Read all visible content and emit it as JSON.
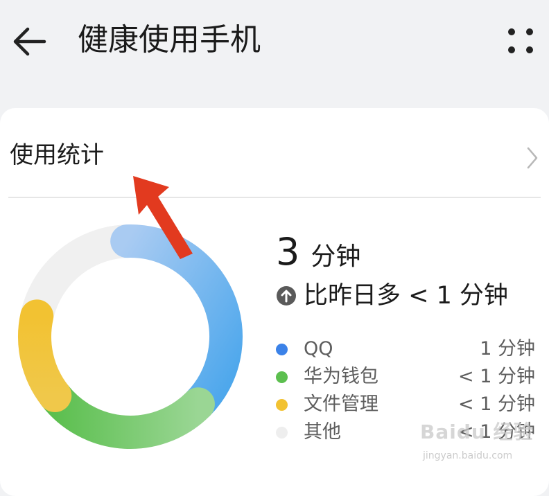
{
  "header": {
    "title": "健康使用手机",
    "back_icon": "arrow-left-icon",
    "more_icon": "more-dots-icon"
  },
  "stats": {
    "title": "使用统计",
    "chevron_icon": "chevron-right-icon"
  },
  "summary": {
    "total_value": "3",
    "total_unit": "分钟",
    "compare_icon": "arrow-up-circle-icon",
    "compare_text": "比昨日多 < 1 分钟"
  },
  "legend": [
    {
      "name": "QQ",
      "value": "1 分钟",
      "color": "#3b82e8"
    },
    {
      "name": "华为钱包",
      "value": "< 1 分钟",
      "color": "#5cbf4f"
    },
    {
      "name": "文件管理",
      "value": "< 1 分钟",
      "color": "#f2c232"
    },
    {
      "name": "其他",
      "value": "< 1 分钟",
      "color": "#eeeeee"
    }
  ],
  "donut_segments": [
    {
      "app": "QQ",
      "share": 0.38,
      "color_start": "#a9cbf2",
      "color_end": "#4aa6ec"
    },
    {
      "app": "华为钱包",
      "share": 0.27,
      "color_start": "#5cbf4f",
      "color_end": "#9ad694"
    },
    {
      "app": "文件管理",
      "share": 0.14,
      "color_start": "#f2c232",
      "color_end": "#f0c84a"
    },
    {
      "app": "其他",
      "share": 0.21,
      "color_start": "#f1f1f1",
      "color_end": "#f1f1f1"
    }
  ],
  "watermark": {
    "main": "Baidu 经验",
    "sub": "jingyan.baidu.com"
  }
}
